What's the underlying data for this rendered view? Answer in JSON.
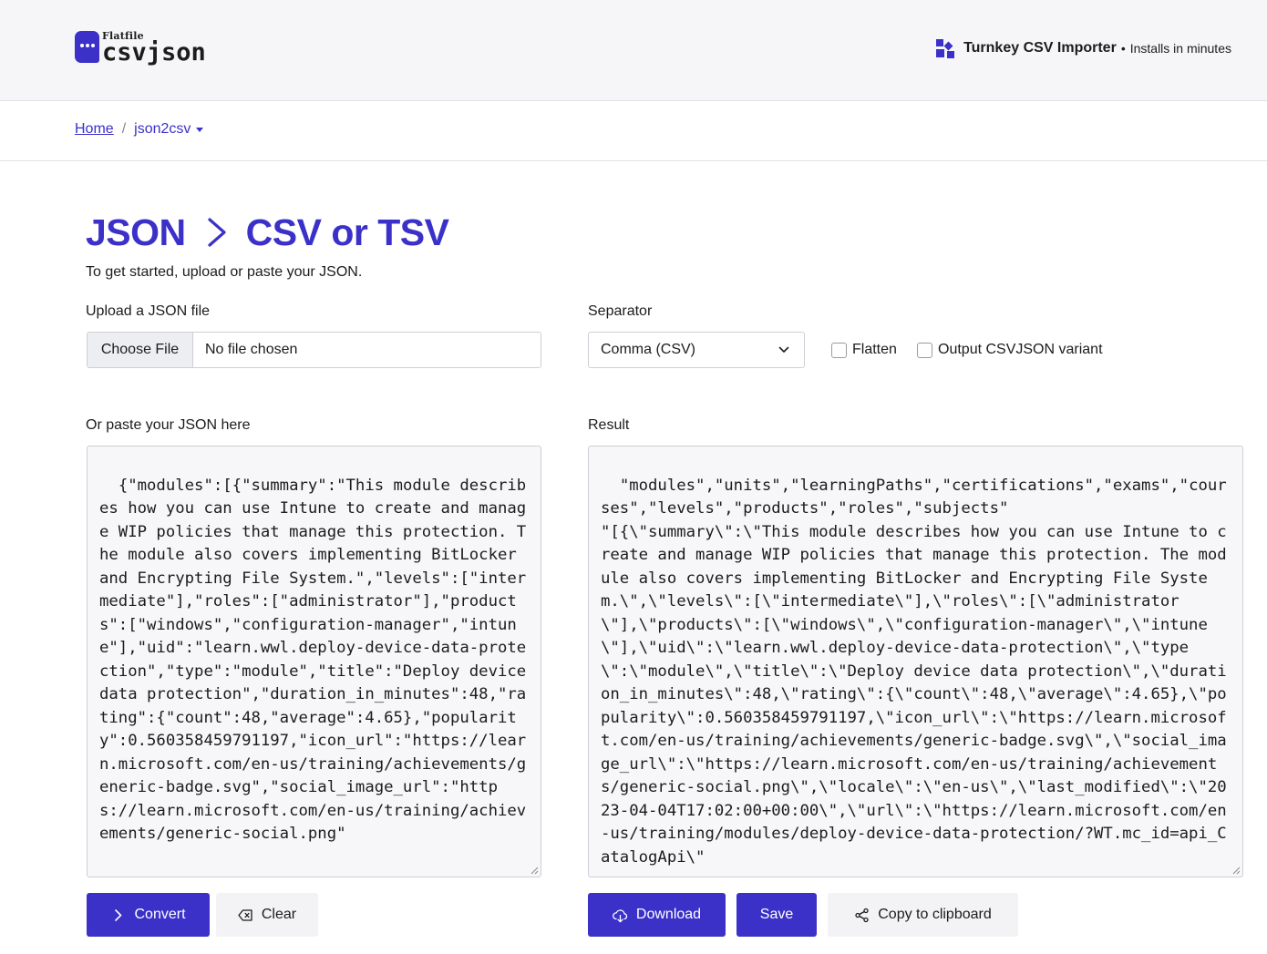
{
  "header": {
    "logo_small": "Flatfile",
    "logo_big": "csvjson",
    "promo_title": "Turnkey CSV Importer",
    "promo_separator": "•",
    "promo_subtitle": "Installs in minutes"
  },
  "breadcrumb": {
    "home": "Home",
    "separator": "/",
    "current": "json2csv"
  },
  "page": {
    "title_left": "JSON",
    "title_right": "CSV or TSV",
    "subtitle": "To get started, upload or paste your JSON."
  },
  "upload": {
    "label": "Upload a JSON file",
    "button": "Choose File",
    "filename": "No file chosen"
  },
  "separator": {
    "label": "Separator",
    "selected": "Comma (CSV)"
  },
  "options": {
    "flatten": {
      "label": "Flatten",
      "checked": false
    },
    "csvjson_variant": {
      "label": "Output CSVJSON variant",
      "checked": false
    }
  },
  "input": {
    "label": "Or paste your JSON here",
    "value": "{\"modules\":[{\"summary\":\"This module describes how you can use Intune to create and manage WIP policies that manage this protection. The module also covers implementing BitLocker and Encrypting File System.\",\"levels\":[\"intermediate\"],\"roles\":[\"administrator\"],\"products\":[\"windows\",\"configuration-manager\",\"intune\"],\"uid\":\"learn.wwl.deploy-device-data-protection\",\"type\":\"module\",\"title\":\"Deploy device data protection\",\"duration_in_minutes\":48,\"rating\":{\"count\":48,\"average\":4.65},\"popularity\":0.560358459791197,\"icon_url\":\"https://learn.microsoft.com/en-us/training/achievements/generic-badge.svg\",\"social_image_url\":\"https://learn.microsoft.com/en-us/training/achievements/generic-social.png\""
  },
  "result": {
    "label": "Result",
    "value": "\"modules\",\"units\",\"learningPaths\",\"certifications\",\"exams\",\"courses\",\"levels\",\"products\",\"roles\",\"subjects\"\n\"[{\\\"summary\\\":\\\"This module describes how you can use Intune to create and manage WIP policies that manage this protection. The module also covers implementing BitLocker and Encrypting File System.\\\",\\\"levels\\\":[\\\"intermediate\\\"],\\\"roles\\\":[\\\"administrator\\\"],\\\"products\\\":[\\\"windows\\\",\\\"configuration-manager\\\",\\\"intune\\\"],\\\"uid\\\":\\\"learn.wwl.deploy-device-data-protection\\\",\\\"type\\\":\\\"module\\\",\\\"title\\\":\\\"Deploy device data protection\\\",\\\"duration_in_minutes\\\":48,\\\"rating\\\":{\\\"count\\\":48,\\\"average\\\":4.65},\\\"popularity\\\":0.560358459791197,\\\"icon_url\\\":\\\"https://learn.microsoft.com/en-us/training/achievements/generic-badge.svg\\\",\\\"social_image_url\\\":\\\"https://learn.microsoft.com/en-us/training/achievements/generic-social.png\\\",\\\"locale\\\":\\\"en-us\\\",\\\"last_modified\\\":\\\"2023-04-04T17:02:00+00:00\\\",\\\"url\\\":\\\"https://learn.microsoft.com/en-us/training/modules/deploy-device-data-protection/?WT.mc_id=api_CatalogApi\\\""
  },
  "actions": {
    "convert": "Convert",
    "clear": "Clear",
    "download": "Download",
    "save": "Save",
    "copy": "Copy to clipboard"
  },
  "icons": {
    "logo": "chat-bubble-icon",
    "promo": "flatfile-blocks-icon",
    "title_arrow": "chevron-right-icon",
    "convert": "chevron-right-icon",
    "clear": "backspace-icon",
    "download": "cloud-download-icon",
    "copy": "share-icon"
  },
  "colors": {
    "brand": "#3b31c9",
    "header_bg": "#f6f6f8",
    "textarea_bg": "#f7f7f9"
  }
}
